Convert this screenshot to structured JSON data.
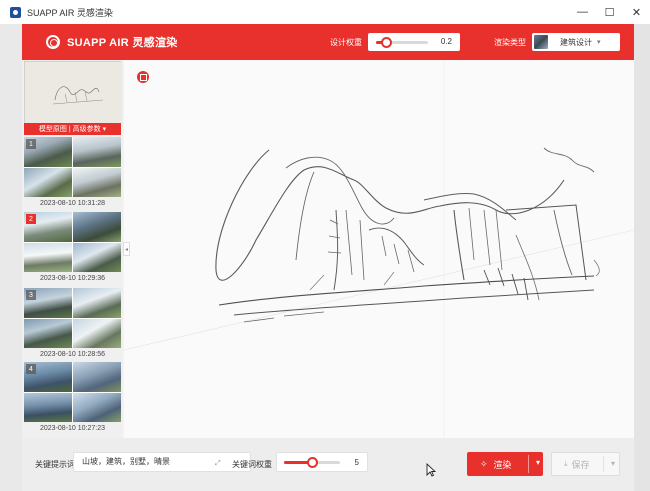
{
  "window": {
    "title": "SUAPP AIR 灵感渲染",
    "controls": {
      "minimize": "—",
      "maximize": "☐",
      "close": "✕"
    }
  },
  "header": {
    "brand": "SUAPP AIR 灵感渲染",
    "design_weight_label": "设计权重",
    "design_weight_value": "0.2",
    "design_weight_fraction": 0.2,
    "render_type_label": "渲染类型",
    "render_type_value": "建筑设计"
  },
  "sidebar": {
    "original_tab": "模型原图 | 高级参数",
    "history": [
      {
        "number": "1",
        "time": "2023-08-10 10:31:28",
        "active": false
      },
      {
        "number": "2",
        "time": "2023-08-10 10:29:36",
        "active": true
      },
      {
        "number": "3",
        "time": "2023-08-10 10:28:56",
        "active": false
      },
      {
        "number": "4",
        "time": "2023-08-10 10:27:23",
        "active": false
      }
    ]
  },
  "bottom": {
    "keyword_label": "关键提示词",
    "keyword_value": "山坡，建筑，别墅，晴景",
    "keyword_weight_label": "关键词权重",
    "keyword_weight_value": "5",
    "keyword_weight_fraction": 0.5,
    "render_button": "渲染",
    "save_button": "保存"
  },
  "colors": {
    "accent": "#e8302c"
  },
  "icons": {
    "brand": "brand-logo-icon",
    "crop": "crop-icon",
    "render": "wand-icon",
    "save": "download-icon",
    "expand": "expand-icon",
    "collapse": "chevron-left-icon"
  }
}
